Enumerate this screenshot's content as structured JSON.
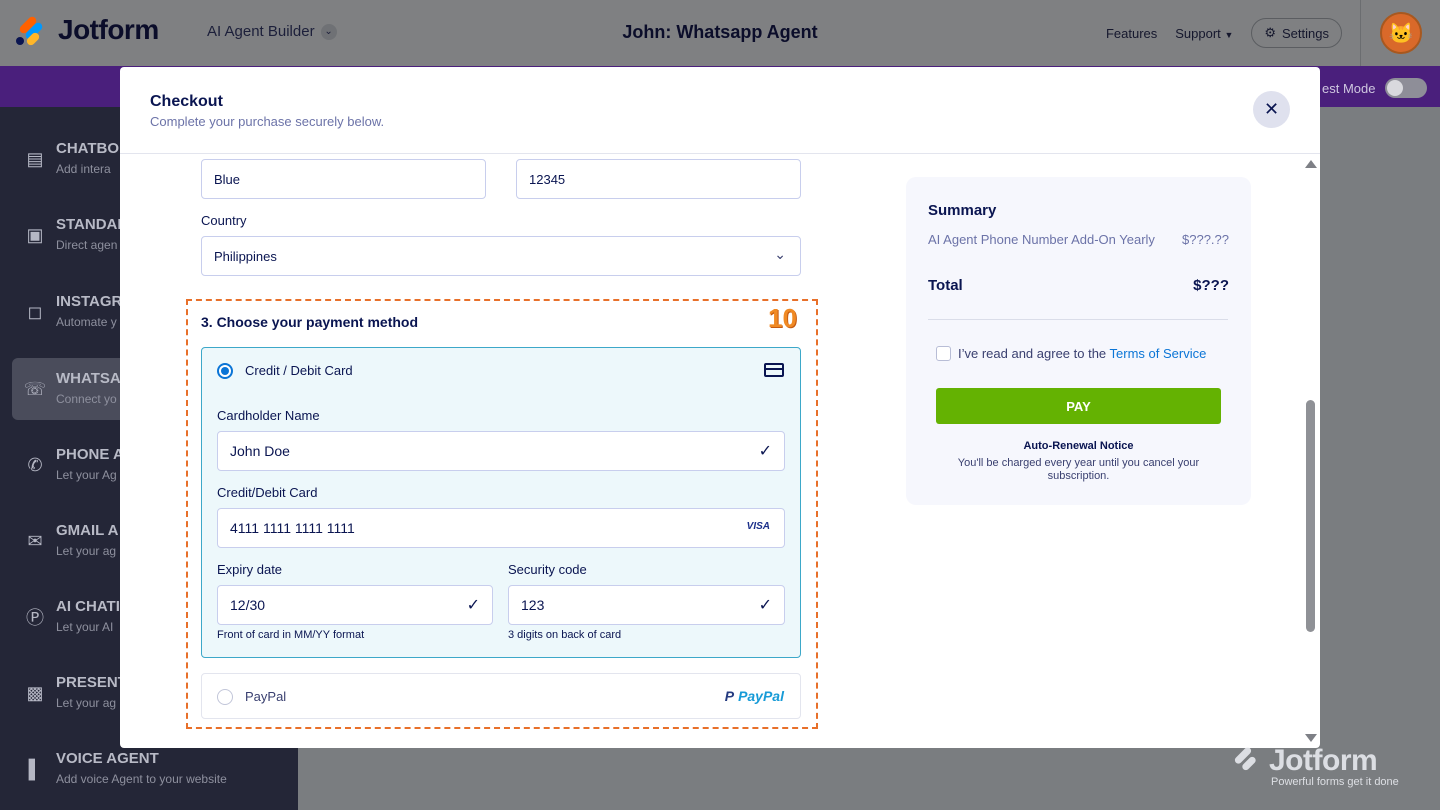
{
  "app": {
    "brand": "Jotform",
    "builder_label": "AI Agent Builder",
    "agent_title": "John: Whatsapp Agent",
    "nav": {
      "features": "Features",
      "support": "Support",
      "settings": "Settings"
    },
    "test_mode": "est Mode"
  },
  "sidebar": {
    "items": [
      {
        "title": "CHATBO",
        "sub": "Add intera",
        "icon": "chat-icon"
      },
      {
        "title": "STANDAI",
        "sub": "Direct agen",
        "icon": "monitor-icon"
      },
      {
        "title": "INSTAGR",
        "sub": "Automate y",
        "icon": "instagram-icon"
      },
      {
        "title": "WHATSA",
        "sub": "Connect yo",
        "icon": "whatsapp-icon"
      },
      {
        "title": "PHONE A",
        "sub": "Let your Ag",
        "icon": "phone-icon"
      },
      {
        "title": "GMAIL A",
        "sub": "Let your ag",
        "icon": "gmail-icon"
      },
      {
        "title": "AI CHATI",
        "sub": "Let your AI",
        "icon": "wordpress-icon"
      },
      {
        "title": "PRESENT",
        "sub": "Let your ag",
        "icon": "presentation-icon"
      },
      {
        "title": "VOICE AGENT",
        "sub": "Add voice Agent to your website",
        "icon": "voice-icon"
      }
    ]
  },
  "checkout": {
    "title": "Checkout",
    "subtitle": "Complete your purchase securely below.",
    "address": {
      "state_value": "Blue",
      "zip_value": "12345",
      "country_label": "Country",
      "country_value": "Philippines"
    },
    "payment": {
      "section_title": "3. Choose your payment method",
      "step_badge": "10",
      "card_option_label": "Credit / Debit Card",
      "cardholder_label": "Cardholder Name",
      "cardholder_value": "John Doe",
      "card_label": "Credit/Debit Card",
      "card_value": "4111 1111 1111 1111",
      "card_brand": "VISA",
      "expiry_label": "Expiry date",
      "expiry_value": "12/30",
      "expiry_hint": "Front of card in MM/YY format",
      "cvc_label": "Security code",
      "cvc_value": "123",
      "cvc_hint": "3 digits on back of card",
      "paypal_label": "PayPal",
      "paypal_logo": "PayPal"
    },
    "summary": {
      "title": "Summary",
      "item_name": "AI Agent Phone Number Add-On Yearly",
      "item_price": "$???.??",
      "total_label": "Total",
      "total_value": "$???",
      "tos_text": "I’ve read and agree to the ",
      "tos_link": "Terms of Service",
      "pay_label": "PAY",
      "renewal_title": "Auto-Renewal Notice",
      "renewal_text": "You'll be charged every year until you cancel your subscription."
    }
  },
  "watermark": {
    "name": "Jotform",
    "tagline": "Powerful forms get it done"
  },
  "colors": {
    "accent_blue": "#0b75d6",
    "pay_green": "#64b202",
    "badge_orange": "#f08a24",
    "sidebar_bg": "#242637",
    "purple_strip": "#4a1f7c"
  }
}
